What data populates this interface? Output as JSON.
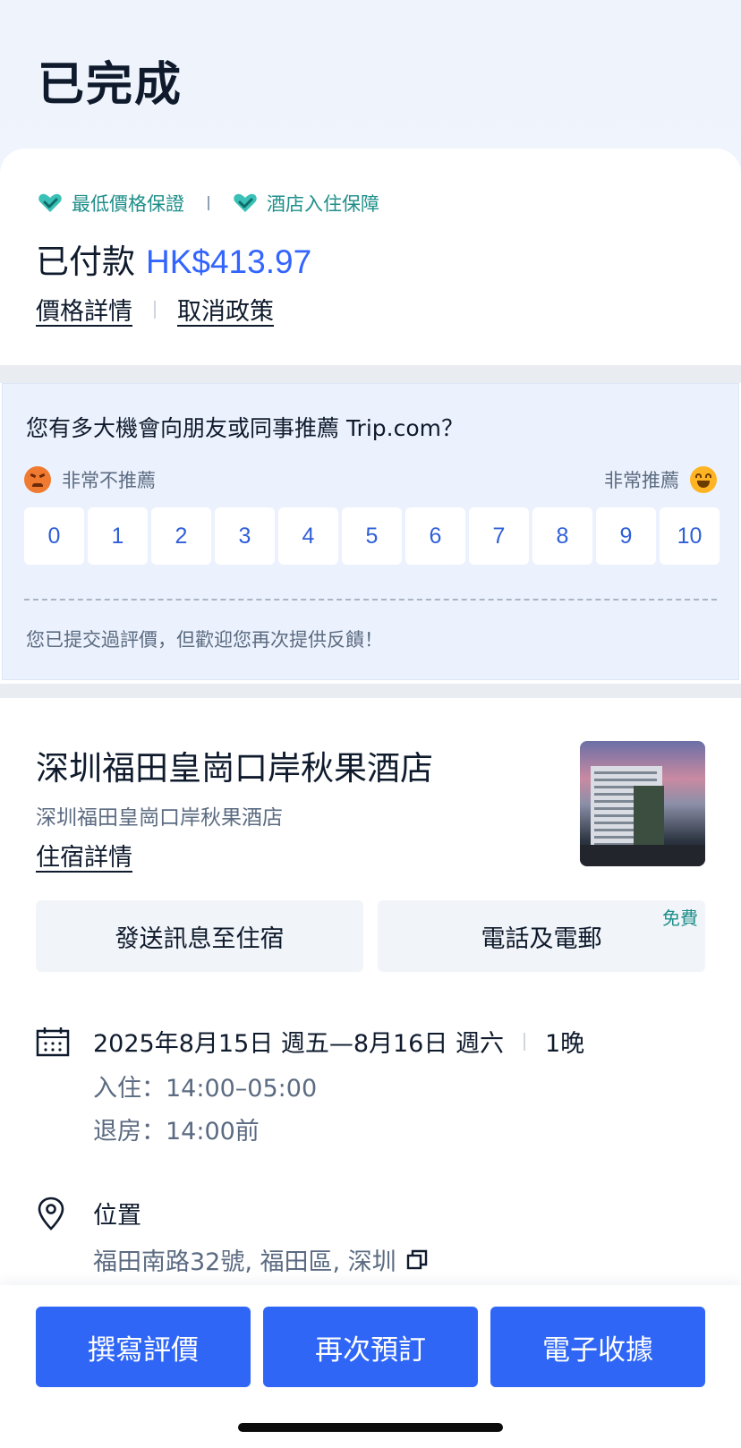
{
  "status": {
    "title": "已完成"
  },
  "guarantees": {
    "items": [
      {
        "label": "最低價格保證",
        "icon": "heart-check-icon"
      },
      {
        "label": "酒店入住保障",
        "icon": "heart-check-icon"
      }
    ],
    "accent": "#1f8f8a"
  },
  "payment": {
    "label": "已付款",
    "amount": "HK$413.97",
    "amount_color": "#3264ff",
    "price_details_link": "價格詳情",
    "cancel_policy_link": "取消政策"
  },
  "survey": {
    "question": "您有多大機會向朋友或同事推薦 Trip.com？",
    "low_label": "非常不推薦",
    "high_label": "非常推薦",
    "scores": [
      "0",
      "1",
      "2",
      "3",
      "4",
      "5",
      "6",
      "7",
      "8",
      "9",
      "10"
    ],
    "note": "您已提交過評價，但歡迎您再次提供反饋！"
  },
  "hotel": {
    "name": "深圳福田皇崗口岸秋果酒店",
    "subtitle": "深圳福田皇崗口岸秋果酒店",
    "details_link": "住宿詳情",
    "photo_icon": "hotel-photo"
  },
  "actions": {
    "message_label": "發送訊息至住宿",
    "phone_email_label": "電話及電郵",
    "free_tag": "免費"
  },
  "stay": {
    "dates": "2025年8月15日 週五—8月16日 週六",
    "nights": "1晚",
    "checkin": "入住：14:00–05:00",
    "checkout": "退房：14:00前"
  },
  "location": {
    "title": "位置",
    "address": "福田南路32號, 福田區, 深圳"
  },
  "bottom": {
    "review_label": "撰寫評價",
    "rebook_label": "再次預訂",
    "receipt_label": "電子收據",
    "button_color": "#2f66f6"
  }
}
